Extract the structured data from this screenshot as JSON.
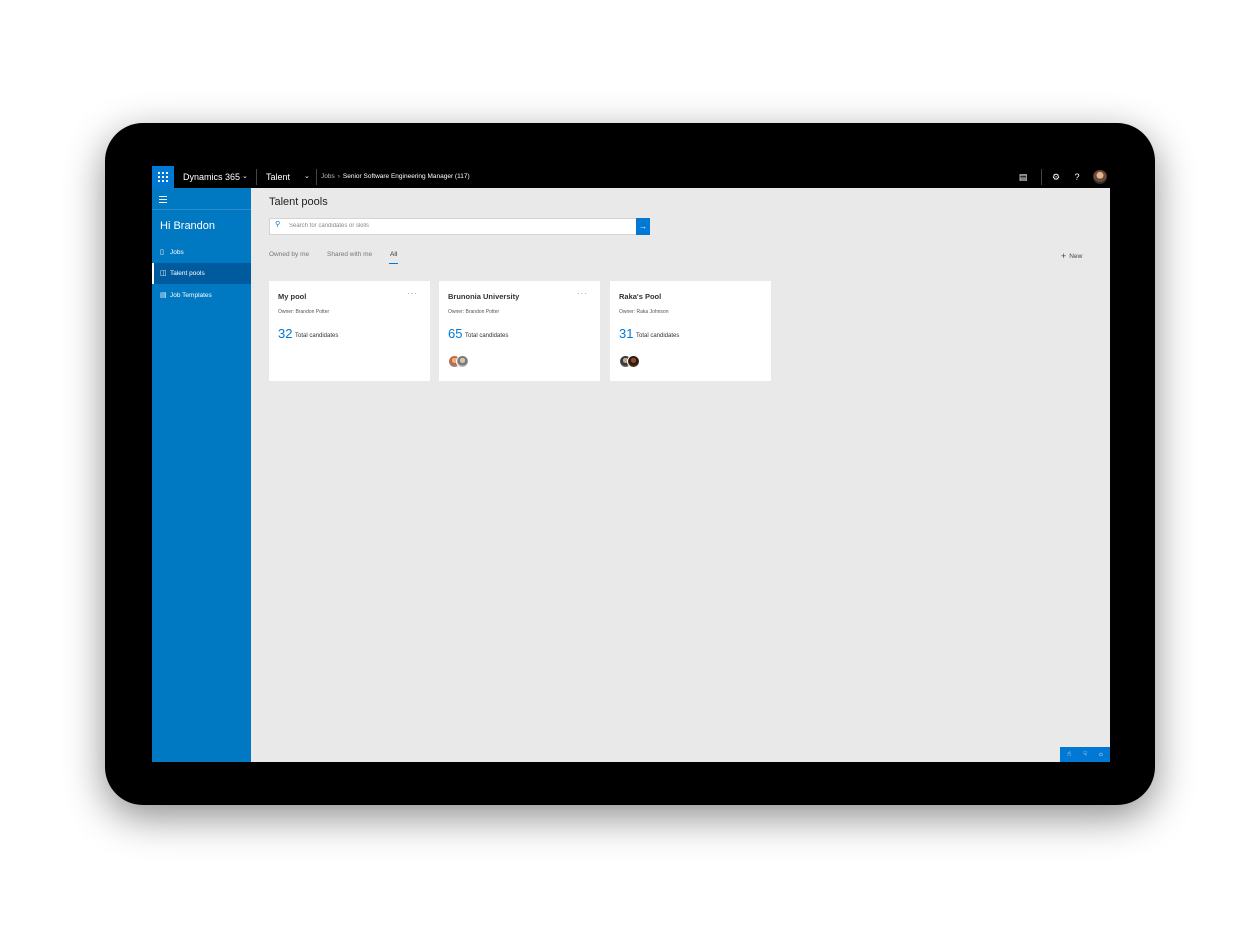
{
  "topbar": {
    "brand": "Dynamics 365",
    "app": "Talent",
    "breadcrumb": {
      "parent": "Jobs",
      "current": "Senior Software Engineering Manager (117)"
    },
    "icons": [
      "waffle-icon",
      "chat-icon",
      "settings-icon",
      "help-icon"
    ]
  },
  "sidebar": {
    "greeting": "Hi Brandon",
    "items": [
      {
        "label": "Jobs",
        "icon": "jobs-icon"
      },
      {
        "label": "Talent pools",
        "icon": "talent-pools-icon",
        "active": true
      },
      {
        "label": "Job Templates",
        "icon": "job-templates-icon"
      }
    ]
  },
  "main": {
    "title": "Talent pools",
    "search": {
      "placeholder": "Search for candidates or skills",
      "value": ""
    },
    "tabs": [
      {
        "label": "Owned by me"
      },
      {
        "label": "Shared with me"
      },
      {
        "label": "All",
        "active": true
      }
    ],
    "new_label": "New",
    "cards": [
      {
        "title": "My pool",
        "owner": "Owner: Brandon Potter",
        "count": "32",
        "count_label": "Total candidates",
        "avatars": 0
      },
      {
        "title": "Brunonia University",
        "owner": "Owner: Brandon Potter",
        "count": "65",
        "count_label": "Total candidates",
        "avatars": 2
      },
      {
        "title": "Raka's Pool",
        "owner": "Owner: Raka Johnson",
        "count": "31",
        "count_label": "Total candidates",
        "avatars": 2
      }
    ]
  },
  "feedback": {
    "icons": [
      "thumbs-up-icon",
      "thumbs-down-icon",
      "lightbulb-icon"
    ]
  },
  "colors": {
    "accent": "#0078d4",
    "sidebar": "#0078c2",
    "sidebar_active": "#005a9e",
    "background": "#e9e9e9"
  }
}
